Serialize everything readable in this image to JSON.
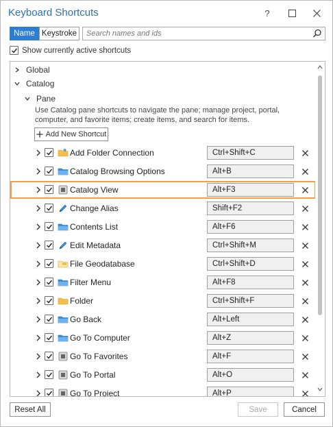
{
  "window": {
    "title": "Keyboard Shortcuts",
    "help_label": "?"
  },
  "toolbar": {
    "tab_name": "Name",
    "tab_keystroke": "Keystroke",
    "search_placeholder": "Search names and ids"
  },
  "show_active": {
    "label": "Show currently active shortcuts",
    "checked": true
  },
  "tree": {
    "global_label": "Global",
    "catalog_label": "Catalog",
    "pane_label": "Pane",
    "pane_description": "Use Catalog pane shortcuts to navigate the pane; manage project, portal, computer, and favorite items; create items, and search for items.",
    "add_shortcut_label": "Add New Shortcut",
    "selected_item": "Catalog View",
    "items": [
      {
        "label": "Add Folder Connection",
        "key": "Ctrl+Shift+C",
        "icon": "folder-connection-icon",
        "checked": true
      },
      {
        "label": "Catalog Browsing Options",
        "key": "Alt+B",
        "icon": "catalog-browse-icon",
        "checked": true
      },
      {
        "label": "Catalog View",
        "key": "Alt+F3",
        "icon": "generic-command-icon",
        "checked": true
      },
      {
        "label": "Change Alias",
        "key": "Shift+F2",
        "icon": "pencil-icon",
        "checked": true
      },
      {
        "label": "Contents List",
        "key": "Alt+F6",
        "icon": "catalog-browse-icon",
        "checked": true
      },
      {
        "label": "Edit Metadata",
        "key": "Ctrl+Shift+M",
        "icon": "pencil-icon",
        "checked": true
      },
      {
        "label": "File Geodatabase",
        "key": "Ctrl+Shift+D",
        "icon": "geodatabase-icon",
        "checked": true
      },
      {
        "label": "Filter Menu",
        "key": "Alt+F8",
        "icon": "catalog-browse-icon",
        "checked": true
      },
      {
        "label": "Folder",
        "key": "Ctrl+Shift+F",
        "icon": "folder-icon",
        "checked": true
      },
      {
        "label": "Go Back",
        "key": "Alt+Left",
        "icon": "catalog-browse-icon",
        "checked": true
      },
      {
        "label": "Go To Computer",
        "key": "Alt+Z",
        "icon": "catalog-browse-icon",
        "checked": true
      },
      {
        "label": "Go To Favorites",
        "key": "Alt+F",
        "icon": "generic-command-icon",
        "checked": true
      },
      {
        "label": "Go To Portal",
        "key": "Alt+O",
        "icon": "generic-command-icon",
        "checked": true
      },
      {
        "label": "Go To Project",
        "key": "Alt+P",
        "icon": "generic-command-icon",
        "checked": true
      }
    ]
  },
  "footer": {
    "reset_label": "Reset All",
    "save_label": "Save",
    "cancel_label": "Cancel"
  },
  "colors": {
    "accent": "#2d7dd2",
    "title": "#2b6fb8",
    "selection_frame": "#f0a04b",
    "folder_yellow": "#f3c04a",
    "icon_blue": "#3b8fd8"
  }
}
